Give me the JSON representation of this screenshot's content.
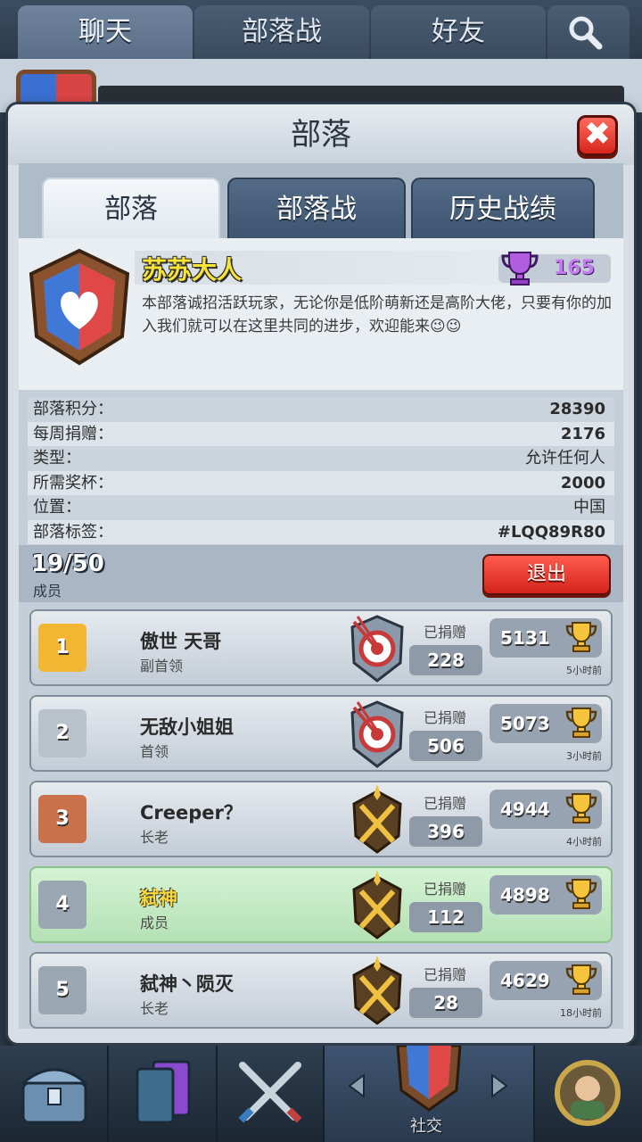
{
  "top_tabs": [
    {
      "label": "聊天"
    },
    {
      "label": "部落战"
    },
    {
      "label": "好友"
    }
  ],
  "modal": {
    "title": "部落",
    "close_label": "✖"
  },
  "sub_tabs": [
    {
      "label": "部落"
    },
    {
      "label": "部落战"
    },
    {
      "label": "历史战绩"
    }
  ],
  "clan": {
    "name": "苏苏大人",
    "trophies": "165",
    "description": "本部落诚招活跃玩家，无论你是低阶萌新还是高阶大佬，只要有你的加入我们就可以在这里共同的进步，欢迎能来😉😉"
  },
  "stats": [
    {
      "label": "部落积分：",
      "value": "28390"
    },
    {
      "label": "每周捐赠：",
      "value": "2176"
    },
    {
      "label": "类型：",
      "value": "允许任何人"
    },
    {
      "label": "所需奖杯：",
      "value": "2000"
    },
    {
      "label": "位置：",
      "value": "中国"
    },
    {
      "label": "部落标签：",
      "value": "#LQQ89R80"
    }
  ],
  "members_header": {
    "count": "19/50",
    "label": "成员",
    "leave_label": "退出"
  },
  "donated_label": "已捐赠",
  "members": [
    {
      "rank": "1",
      "name": "傲世 天哥",
      "role": "副首领",
      "donated": "228",
      "trophies": "5131",
      "time": "5小时前",
      "rank_color": "#f2b632"
    },
    {
      "rank": "2",
      "name": "无敌小姐姐",
      "role": "首领",
      "donated": "506",
      "trophies": "5073",
      "time": "3小时前",
      "rank_color": "#b9c2cb"
    },
    {
      "rank": "3",
      "name": "Creeper？",
      "role": "长老",
      "donated": "396",
      "trophies": "4944",
      "time": "4小时前",
      "rank_color": "#c8714a"
    },
    {
      "rank": "4",
      "name": "弑神",
      "role": "成员",
      "donated": "112",
      "trophies": "4898",
      "time": "",
      "rank_color": "#9aa6b2"
    },
    {
      "rank": "5",
      "name": "弑神丶陨灭",
      "role": "长老",
      "donated": "28",
      "trophies": "4629",
      "time": "18小时前",
      "rank_color": "#9aa6b2"
    }
  ],
  "bottom_nav": {
    "social_label": "社交"
  }
}
